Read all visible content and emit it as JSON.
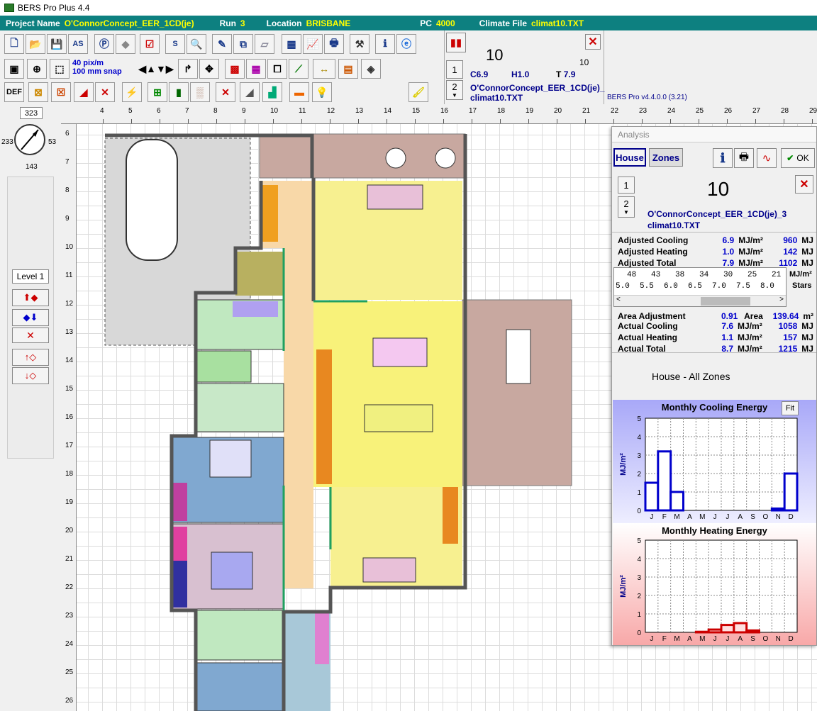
{
  "window": {
    "title": "BERS Pro Plus 4.4"
  },
  "info": {
    "project_label": "Project Name",
    "project": "O'ConnorConcept_EER_1CD(je)",
    "run_label": "Run",
    "run": "3",
    "location_label": "Location",
    "location": "BRISBANE",
    "pc_label": "PC",
    "pc": "4000",
    "climate_label": "Climate File",
    "climate": "climat10.TXT"
  },
  "toolbar": {
    "as_label": "AS",
    "s_label": "S",
    "def_label": "DEF",
    "snap_line1": "40 pix/m",
    "snap_line2": "100 mm snap"
  },
  "summary": {
    "stars": "10",
    "stars_small": "10",
    "btn1": "1",
    "btn2": "2",
    "cooling": "C6.9",
    "heating": "H1.0",
    "total_label": "T",
    "total": "7.9",
    "file1": "O'ConnorConcept_EER_1CD(je)_",
    "file2": "climat10.TXT",
    "version": "BERS Pro v4.4.0.0 (3.21)"
  },
  "compass": {
    "input": "323",
    "n": "143",
    "w": "233",
    "e": "53"
  },
  "level": {
    "label": "Level 1"
  },
  "ruler": {
    "top": [
      "4",
      "5",
      "6",
      "7",
      "8",
      "9",
      "10",
      "11",
      "12",
      "13",
      "14",
      "15",
      "16",
      "17",
      "18",
      "19",
      "20",
      "21",
      "22",
      "23",
      "24",
      "25",
      "26",
      "27",
      "28",
      "29"
    ],
    "left": [
      "6",
      "7",
      "8",
      "9",
      "10",
      "11",
      "12",
      "13",
      "14",
      "15",
      "16",
      "17",
      "18",
      "19",
      "20",
      "21",
      "22",
      "23",
      "24",
      "25",
      "26"
    ]
  },
  "analysis": {
    "title": "Analysis",
    "tab_house": "House",
    "tab_zones": "Zones",
    "ok": "OK",
    "btn1": "1",
    "btn2": "2",
    "stars": "10",
    "file1": "O'ConnorConcept_EER_1CD(je)_3",
    "file2": "climat10.TXT",
    "rows": [
      {
        "label": "Adjusted Cooling",
        "v1": "6.9",
        "u1": "MJ/m²",
        "v2": "960",
        "u2": "MJ"
      },
      {
        "label": "Adjusted Heating",
        "v1": "1.0",
        "u1": "MJ/m²",
        "v2": "142",
        "u2": "MJ"
      },
      {
        "label": "Adjusted Total",
        "v1": "7.9",
        "u1": "MJ/m²",
        "v2": "1102",
        "u2": "MJ"
      }
    ],
    "scale_top": [
      "48",
      "43",
      "38",
      "34",
      "30",
      "25",
      "21"
    ],
    "scale_bottom": [
      "5.0",
      "5.5",
      "6.0",
      "6.5",
      "7.0",
      "7.5",
      "8.0"
    ],
    "scale_unit_top": "MJ/m²",
    "scale_unit_bottom": "Stars",
    "area_adj_label": "Area Adjustment",
    "area_adj": "0.91",
    "area_label": "Area",
    "area": "139.64",
    "area_unit": "m²",
    "rows2": [
      {
        "label": "Actual Cooling",
        "v1": "7.6",
        "u1": "MJ/m²",
        "v2": "1058",
        "u2": "MJ"
      },
      {
        "label": "Actual Heating",
        "v1": "1.1",
        "u1": "MJ/m²",
        "v2": "157",
        "u2": "MJ"
      },
      {
        "label": "Actual Total",
        "v1": "8.7",
        "u1": "MJ/m²",
        "v2": "1215",
        "u2": "MJ"
      }
    ],
    "zone_label": "House - All Zones",
    "fit": "Fit"
  },
  "colors": {
    "teal": "#0d8080",
    "yellow_text": "#ffff00",
    "navy": "#00008b",
    "cool_bar": "#0000cc",
    "heat_bar": "#cc0000"
  },
  "chart_data": [
    {
      "type": "bar",
      "title": "Monthly Cooling Energy",
      "ylabel": "MJ/m²",
      "categories": [
        "J",
        "F",
        "M",
        "A",
        "M",
        "J",
        "J",
        "A",
        "S",
        "O",
        "N",
        "D"
      ],
      "values": [
        1.5,
        3.2,
        1.0,
        0,
        0,
        0,
        0,
        0,
        0,
        0,
        0.1,
        2.0
      ],
      "ylim": [
        0,
        5
      ],
      "yticks": [
        "0",
        "1",
        "2",
        "3",
        "4",
        "5"
      ],
      "grid": true
    },
    {
      "type": "bar",
      "title": "Monthly Heating Energy",
      "ylabel": "MJ/m²",
      "categories": [
        "J",
        "F",
        "M",
        "A",
        "M",
        "J",
        "J",
        "A",
        "S",
        "O",
        "N",
        "D"
      ],
      "values": [
        0,
        0,
        0,
        0,
        0.03,
        0.15,
        0.4,
        0.5,
        0.1,
        0,
        0,
        0
      ],
      "ylim": [
        0,
        5
      ],
      "yticks": [
        "0",
        "1",
        "2",
        "3",
        "4",
        "5"
      ],
      "grid": true
    }
  ]
}
